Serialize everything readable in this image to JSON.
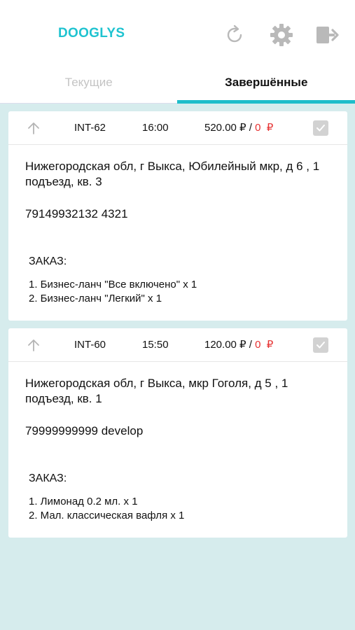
{
  "app": {
    "brand": "DOOGLYS"
  },
  "header_icons": {
    "refresh": "refresh-icon",
    "settings": "gear-icon",
    "logout": "logout-icon"
  },
  "tabs": [
    {
      "label": "Текущие",
      "active": false
    },
    {
      "label": "Завершённые",
      "active": true
    }
  ],
  "colors": {
    "accent": "#1fc3d0",
    "background": "#d6eced",
    "price_red": "#e63030"
  },
  "orders": [
    {
      "code": "INT-62",
      "time": "16:00",
      "price": "520.00 ₽",
      "separator": " / ",
      "discount": "0",
      "discount_currency": "₽",
      "address": "Нижегородская обл, г Выкса, Юбилейный мкр, д 6 ,  1 подъезд,  кв. 3",
      "phone": "79149932132  4321",
      "order_title": "ЗАКАЗ:",
      "items": [
        "1. Бизнес-ланч \"Все включено\" x 1",
        "2. Бизнес-ланч \"Легкий\" x 1"
      ]
    },
    {
      "code": "INT-60",
      "time": "15:50",
      "price": "120.00 ₽",
      "separator": " / ",
      "discount": "0",
      "discount_currency": "₽",
      "address": "Нижегородская обл, г Выкса, мкр Гоголя, д 5 ,  1 подъезд,  кв. 1",
      "phone": "79999999999  develop",
      "order_title": "ЗАКАЗ:",
      "items": [
        "1. Лимонад 0.2 мл. x 1",
        "2. Мал. классическая вафля x 1"
      ]
    }
  ]
}
